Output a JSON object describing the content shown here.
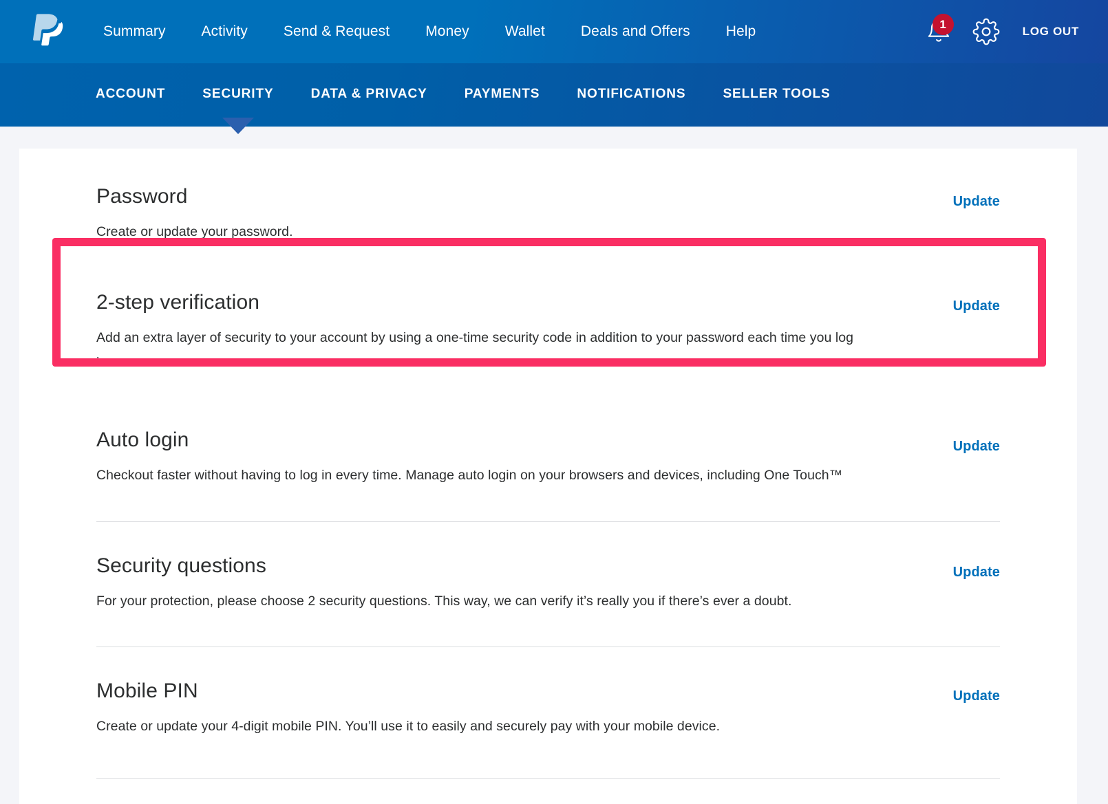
{
  "header": {
    "logo_icon": "paypal-logo-icon",
    "nav": [
      {
        "label": "Summary"
      },
      {
        "label": "Activity"
      },
      {
        "label": "Send & Request"
      },
      {
        "label": "Money"
      },
      {
        "label": "Wallet"
      },
      {
        "label": "Deals and Offers"
      },
      {
        "label": "Help"
      }
    ],
    "notifications": {
      "icon": "bell-icon",
      "count": "1"
    },
    "settings_icon": "gear-icon",
    "logout_label": "LOG OUT"
  },
  "subnav": {
    "items": [
      {
        "label": "ACCOUNT",
        "active": false
      },
      {
        "label": "SECURITY",
        "active": true
      },
      {
        "label": "DATA & PRIVACY",
        "active": false
      },
      {
        "label": "PAYMENTS",
        "active": false
      },
      {
        "label": "NOTIFICATIONS",
        "active": false
      },
      {
        "label": "SELLER TOOLS",
        "active": false
      }
    ]
  },
  "main": {
    "sections": [
      {
        "title": "Password",
        "description": "Create or update your password.",
        "action_label": "Update",
        "highlighted": false
      },
      {
        "title": "2-step verification",
        "description": "Add an extra layer of security to your account by using a one-time security code in addition to your password each time you log in.",
        "action_label": "Update",
        "highlighted": true
      },
      {
        "title": "Auto login",
        "description": "Checkout faster without having to log in every time. Manage auto login on your browsers and devices, including One Touch™",
        "action_label": "Update",
        "highlighted": false
      },
      {
        "title": "Security questions",
        "description": "For your protection, please choose 2 security questions. This way, we can verify it’s really you if there’s ever a doubt.",
        "action_label": "Update",
        "highlighted": false
      },
      {
        "title": "Mobile PIN",
        "description": "Create or update your 4-digit mobile PIN. You’ll use it to easily and securely pay with your mobile device.",
        "action_label": "Update",
        "highlighted": false
      }
    ]
  },
  "colors": {
    "brand_blue": "#0070ba",
    "brand_dark_blue": "#1546a0",
    "link_blue": "#0070ba",
    "badge_red": "#c4122f",
    "highlight_pink": "#fa2e63",
    "page_bg": "#f4f5f9",
    "card_bg": "#ffffff",
    "divider": "#dcdee1",
    "text": "#2c2e2f"
  }
}
